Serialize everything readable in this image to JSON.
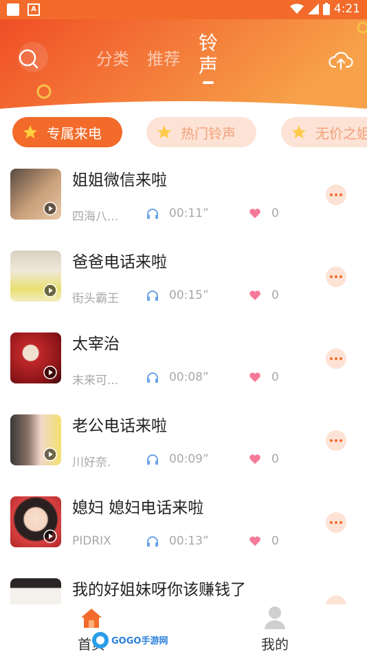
{
  "status_bar": {
    "time": "4:21"
  },
  "header": {
    "tabs": [
      {
        "label": "分类"
      },
      {
        "label": "推荐"
      },
      {
        "label": "铃声"
      }
    ],
    "active_tab": 2,
    "colors": {
      "gradient_start": "#f04e26",
      "gradient_end": "#f7a24a"
    }
  },
  "chips": [
    {
      "label": "专属来电",
      "active": true
    },
    {
      "label": "热门铃声",
      "active": false
    },
    {
      "label": "无价之姐",
      "active": false
    }
  ],
  "ringtones": [
    {
      "title": "姐姐微信来啦",
      "author": "四海八...",
      "duration": "00:11”",
      "likes": "0"
    },
    {
      "title": "爸爸电话来啦",
      "author": "街头霸王",
      "duration": "00:15”",
      "likes": "0"
    },
    {
      "title": "太宰治",
      "author": "末来可...",
      "duration": "00:08”",
      "likes": "0"
    },
    {
      "title": "老公电话来啦",
      "author": "川好奈.",
      "duration": "00:09”",
      "likes": "0"
    },
    {
      "title": "媳妇 媳妇电话来啦",
      "author": "PIDRIX",
      "duration": "00:13”",
      "likes": "0"
    },
    {
      "title": "我的好姐妹呀你该赚钱了",
      "author": "",
      "duration": "",
      "likes": ""
    }
  ],
  "bottom_nav": {
    "home": {
      "label": "首页",
      "icon": "home-icon"
    },
    "mine": {
      "label": "我的",
      "icon": "user-icon"
    }
  },
  "watermark": {
    "text": "GOGO手游网"
  },
  "accent_color": "#f26b2a"
}
